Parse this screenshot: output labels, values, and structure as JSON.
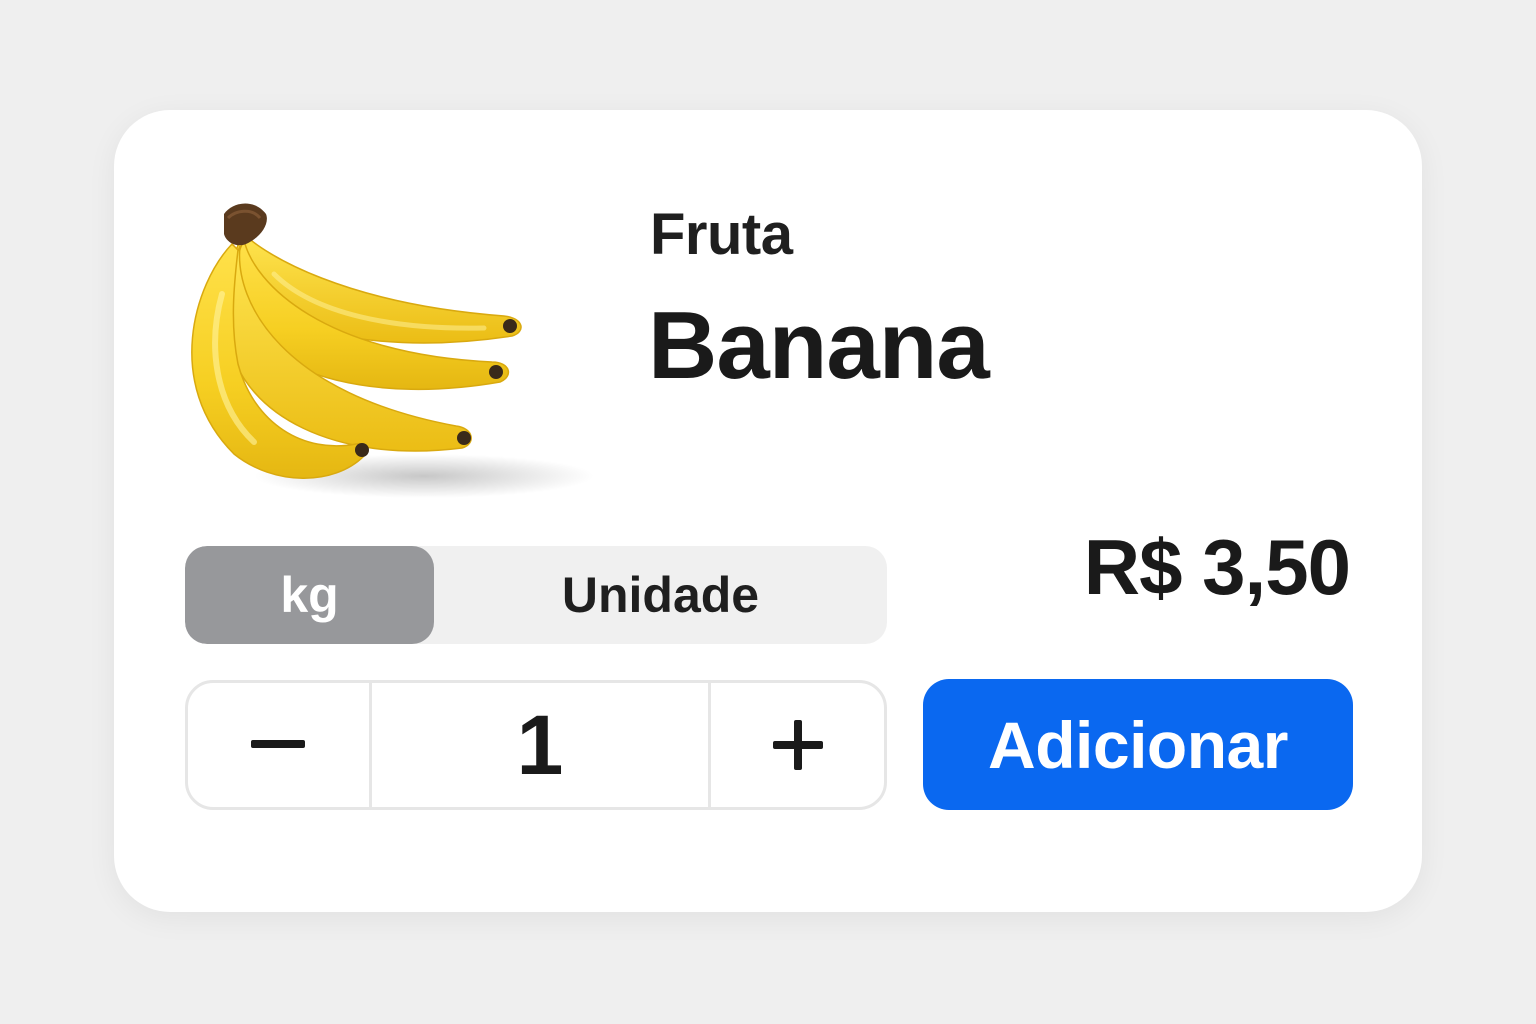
{
  "product": {
    "category": "Fruta",
    "name": "Banana",
    "price": "R$ 3,50",
    "image_icon": "banana-bunch-image"
  },
  "unit_toggle": {
    "options": [
      {
        "label": "kg",
        "selected": true
      },
      {
        "label": "Unidade",
        "selected": false
      }
    ]
  },
  "quantity": {
    "value": "1",
    "decrement_icon": "minus-icon",
    "increment_icon": "plus-icon"
  },
  "actions": {
    "add_label": "Adicionar"
  },
  "colors": {
    "background": "#efefef",
    "card": "#ffffff",
    "accent": "#0a68f0",
    "toggle_selected": "#97989b",
    "toggle_bg": "#f0f0f0",
    "banana_yellow": "#f6d02b"
  }
}
